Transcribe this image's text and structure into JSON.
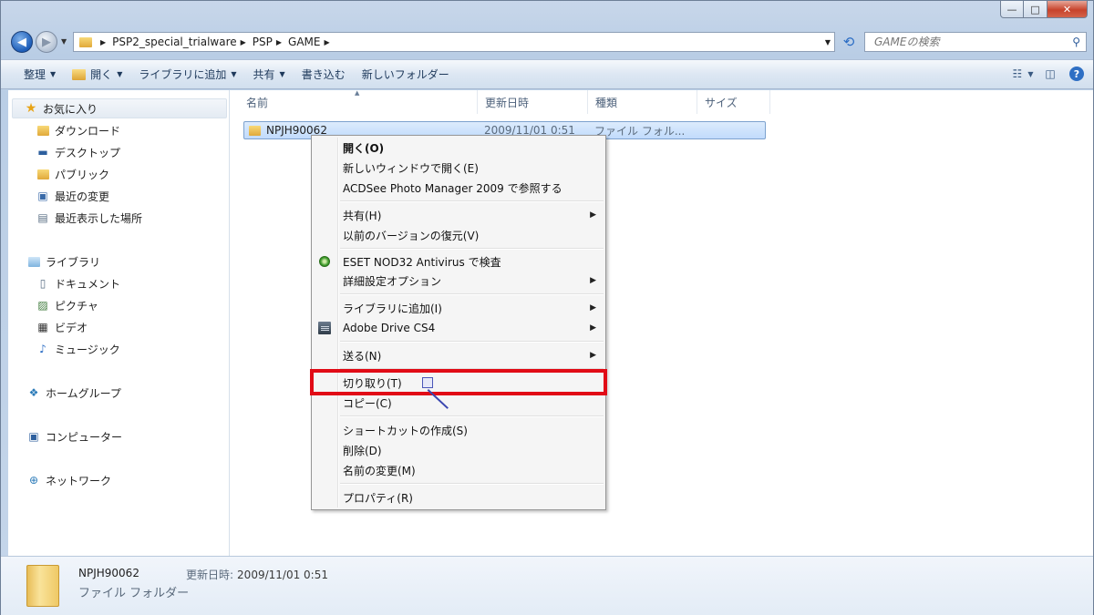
{
  "window": {
    "min_glyph": "—",
    "max_glyph": "□",
    "close_glyph": "✕"
  },
  "address": {
    "crumbs": [
      "PSP2_special_trialware",
      "PSP",
      "GAME"
    ],
    "search_placeholder": "GAMEの検索"
  },
  "toolbar": {
    "organize": "整理",
    "open": "開く",
    "add_to_library": "ライブラリに追加",
    "share": "共有",
    "burn": "書き込む",
    "new_folder": "新しいフォルダー"
  },
  "sidebar": {
    "favorites": {
      "label": "お気に入り",
      "items": [
        "ダウンロード",
        "デスクトップ",
        "パブリック",
        "最近の変更",
        "最近表示した場所"
      ]
    },
    "libraries": {
      "label": "ライブラリ",
      "items": [
        "ドキュメント",
        "ピクチャ",
        "ビデオ",
        "ミュージック"
      ]
    },
    "homegroup": "ホームグループ",
    "computer": "コンピューター",
    "network": "ネットワーク"
  },
  "columns": [
    "名前",
    "更新日時",
    "種類",
    "サイズ"
  ],
  "files": [
    {
      "name": "NPJH90062",
      "date": "2009/11/01 0:51",
      "type": "ファイル フォル..."
    }
  ],
  "context_menu": {
    "open": "開く(O)",
    "open_new_window": "新しいウィンドウで開く(E)",
    "acdsee": "ACDSee Photo Manager 2009 で参照する",
    "share": "共有(H)",
    "restore_previous": "以前のバージョンの復元(V)",
    "eset": "ESET NOD32 Antivirus で検査",
    "advanced": "詳細設定オプション",
    "add_library": "ライブラリに追加(I)",
    "adobe_drive": "Adobe Drive CS4",
    "send_to": "送る(N)",
    "cut": "切り取り(T)",
    "copy": "コピー(C)",
    "create_shortcut": "ショートカットの作成(S)",
    "delete": "削除(D)",
    "rename": "名前の変更(M)",
    "properties": "プロパティ(R)"
  },
  "details": {
    "name": "NPJH90062",
    "date_label": "更新日時:",
    "date": "2009/11/01 0:51",
    "type": "ファイル フォルダー"
  },
  "colors": {
    "highlight_border": "#e10b16",
    "selection": "#c1dbfc"
  }
}
